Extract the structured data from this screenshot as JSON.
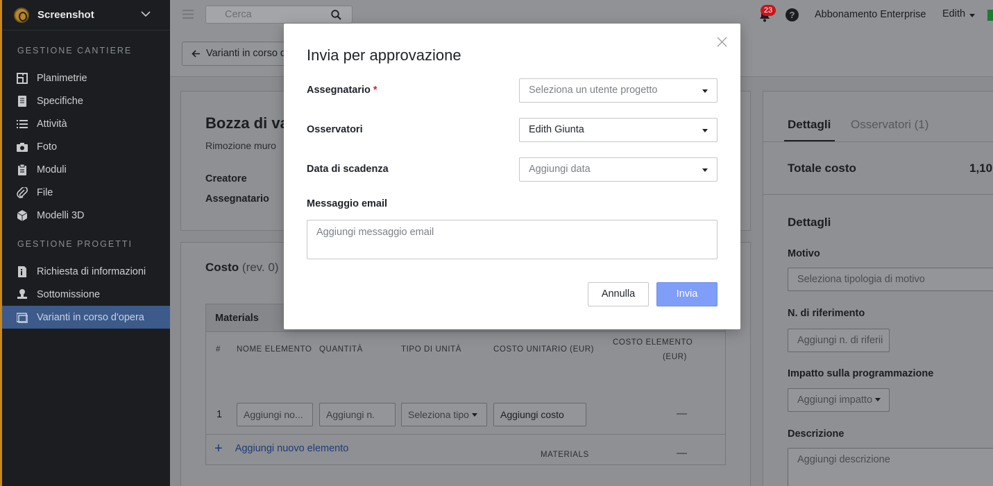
{
  "sidebar": {
    "brand": "Screenshot",
    "sections": [
      {
        "title": "GESTIONE CANTIERE"
      },
      {
        "title": "GESTIONE PROGETTI"
      }
    ],
    "items": [
      {
        "label": "Planimetrie",
        "icon": "blueprint-icon"
      },
      {
        "label": "Specifiche",
        "icon": "spec-book-icon"
      },
      {
        "label": "Attività",
        "icon": "list-icon"
      },
      {
        "label": "Foto",
        "icon": "camera-icon"
      },
      {
        "label": "Moduli",
        "icon": "clipboard-icon"
      },
      {
        "label": "File",
        "icon": "paperclip-icon"
      },
      {
        "label": "Modelli 3D",
        "icon": "cube-icon"
      },
      {
        "label": "Richiesta di informazioni",
        "icon": "info-doc-icon"
      },
      {
        "label": "Sottomissione",
        "icon": "stamp-icon"
      },
      {
        "label": "Varianti in corso d'opera",
        "icon": "change-order-icon"
      }
    ],
    "active_item": "Varianti in corso d'opera",
    "accent_color": "#3c5a8a"
  },
  "topbar": {
    "search_placeholder": "Cerca",
    "notifications_count": "23",
    "help_label": "?",
    "plan": "Abbonamento Enterprise",
    "user": "Edith"
  },
  "page": {
    "back_label": "Varianti in corso d",
    "draft_title": "Bozza di var",
    "draft_subtitle": "Rimozione muro",
    "creator_label": "Creatore",
    "assignee_label": "Assegnatario",
    "cost_title": "Costo",
    "cost_rev": "(rev. 0)",
    "materials": {
      "header": "Materials",
      "columns": [
        "#",
        "NOME ELEMENTO",
        "QUANTITÀ",
        "TIPO DI UNITÀ",
        "COSTO UNITARIO (EUR)",
        "COSTO ELEMENTO",
        "(EUR)"
      ],
      "row_num": "1",
      "inputs": [
        "Aggiungi no...",
        "Aggiungi n.",
        "Seleziona tipo",
        "Aggiungi costo"
      ],
      "row_total": "—",
      "add_label": "Aggiungi nuovo elemento",
      "add_symbol": "+",
      "footer_label": "MATERIALS",
      "footer_total": "—"
    }
  },
  "right_panel": {
    "tabs": [
      "Dettagli",
      "Osservatori (1)"
    ],
    "total_label": "Totale costo",
    "total_value": "1,10",
    "details_heading": "Dettagli",
    "reason_label": "Motivo",
    "reason_placeholder": "Seleziona tipologia di motivo",
    "ref_label": "N. di riferimento",
    "ref_placeholder": "Aggiungi n. di riferii",
    "impact_label": "Impatto sulla programmazione",
    "impact_placeholder": "Aggiungi impatto",
    "desc_label": "Descrizione",
    "desc_placeholder": "Aggiungi descrizione"
  },
  "modal": {
    "title": "Invia per approvazione",
    "assignee_label": "Assegnatario",
    "required_mark": "*",
    "assignee_placeholder": "Seleziona un utente progetto",
    "observers_label": "Osservatori",
    "observers_value": "Edith Giunta",
    "due_date_label": "Data di scadenza",
    "due_date_placeholder": "Aggiungi data",
    "email_label": "Messaggio email",
    "email_placeholder": "Aggiungi messaggio email",
    "cancel_label": "Annulla",
    "send_label": "Invia",
    "send_color": "#7f9ef7"
  }
}
